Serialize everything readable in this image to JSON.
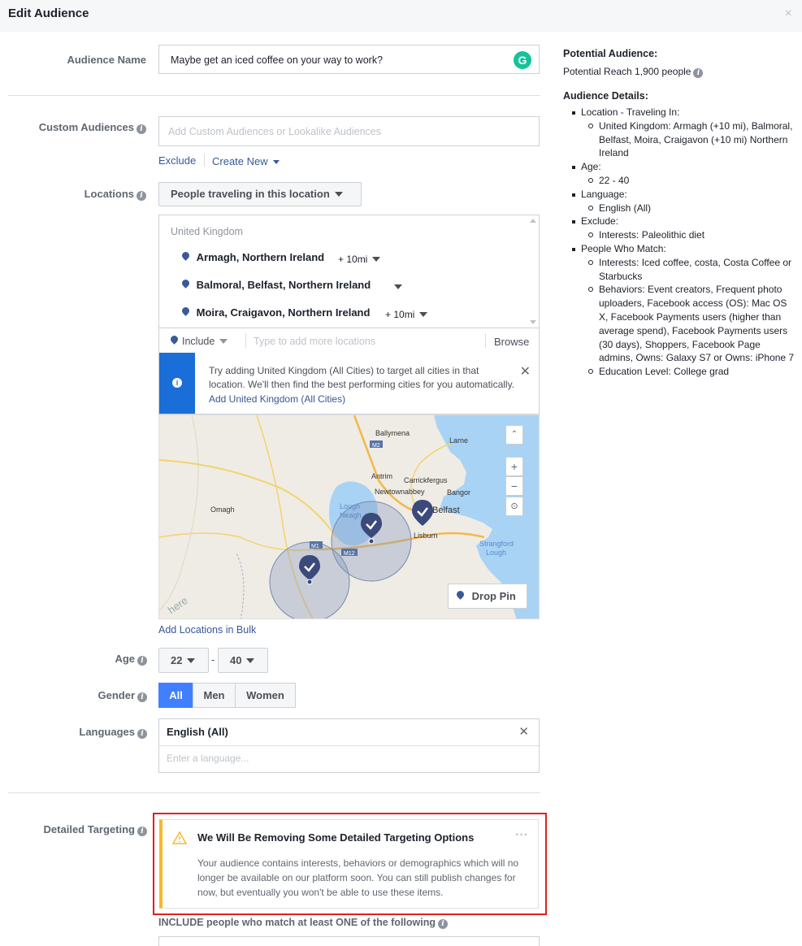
{
  "header": {
    "title": "Edit Audience",
    "close_glyph": "×"
  },
  "audience_name": {
    "label": "Audience Name",
    "value": "Maybe get an iced coffee on your way to work?"
  },
  "custom_audiences": {
    "label": "Custom Audiences",
    "placeholder": "Add Custom Audiences or Lookalike Audiences",
    "exclude": "Exclude",
    "create_new": "Create New"
  },
  "locations": {
    "label": "Locations",
    "mode": "People traveling in this location",
    "country": "United Kingdom",
    "items": [
      {
        "name": "Armagh, Northern Ireland",
        "radius": "+ 10mi"
      },
      {
        "name": "Balmoral, Belfast, Northern Ireland",
        "radius": ""
      },
      {
        "name": "Moira, Craigavon, Northern Ireland",
        "radius": "+ 10mi"
      }
    ],
    "include": "Include",
    "placeholder": "Type to add more locations",
    "browse": "Browse",
    "suggestion": "Try adding United Kingdom (All Cities) to target all cities in that location. We'll then find the best performing cities for you automatically.",
    "suggestion_link": "Add United Kingdom (All Cities)",
    "bulk_link": "Add Locations in Bulk",
    "map": {
      "labels": {
        "ballymena": "Ballymena",
        "larne": "Larne",
        "antrim": "Antrim",
        "carrickfergus": "Carrickfergus",
        "newtownabbey": "Newtownabbey",
        "bangor": "Bangor",
        "omagh": "Omagh",
        "lough_neagh_1": "Lough",
        "lough_neagh_2": "Neagh",
        "belfast": "Belfast",
        "lisburn": "Lisburn",
        "strangford_1": "Strangford",
        "strangford_2": "Lough",
        "m1": "M1",
        "m12": "M12",
        "m2": "M2",
        "here": "here"
      },
      "zoom_in": "+",
      "zoom_out": "−",
      "drop_pin": "Drop Pin"
    }
  },
  "age": {
    "label": "Age",
    "min": "22",
    "max": "40",
    "sep": "-"
  },
  "gender": {
    "label": "Gender",
    "options": [
      "All",
      "Men",
      "Women"
    ],
    "selected": "All"
  },
  "languages": {
    "label": "Languages",
    "selected": "English (All)",
    "placeholder": "Enter a language..."
  },
  "detailed_targeting": {
    "label": "Detailed Targeting",
    "warning_title": "We Will Be Removing Some Detailed Targeting Options",
    "warning_body": "Your audience contains interests, behaviors or demographics which will no longer be available on our platform soon. You can still publish changes for now, but eventually you won't be able to use these items.",
    "more": "···",
    "include_text": "INCLUDE people who match at least ONE of the following"
  },
  "right_panel": {
    "potential_title": "Potential Audience:",
    "potential_reach": "Potential Reach 1,900 people",
    "details_title": "Audience Details:",
    "sections": [
      {
        "title": "Location - Traveling In:",
        "items": [
          "United Kingdom: Armagh (+10 mi), Balmoral, Belfast, Moira, Craigavon (+10 mi) Northern Ireland"
        ]
      },
      {
        "title": "Age:",
        "items": [
          "22 - 40"
        ]
      },
      {
        "title": "Language:",
        "items": [
          "English (All)"
        ]
      },
      {
        "title": "Exclude:",
        "items": [
          "Interests: Paleolithic diet"
        ]
      },
      {
        "title": "People Who Match:",
        "items": [
          "Interests: Iced coffee, costa, Costa Coffee or Starbucks",
          "Behaviors: Event creators, Frequent photo uploaders, Facebook access (OS): Mac OS X, Facebook Payments users (higher than average spend), Facebook Payments users (30 days), Shoppers, Facebook Page admins, Owns: Galaxy S7 or Owns: iPhone 7",
          "Education Level: College grad"
        ]
      }
    ]
  },
  "colors": {
    "accent": "#4080ff",
    "link": "#365899",
    "warning": "#f7b928",
    "highlight_border": "#e02020",
    "grammarly": "#15c39a"
  }
}
